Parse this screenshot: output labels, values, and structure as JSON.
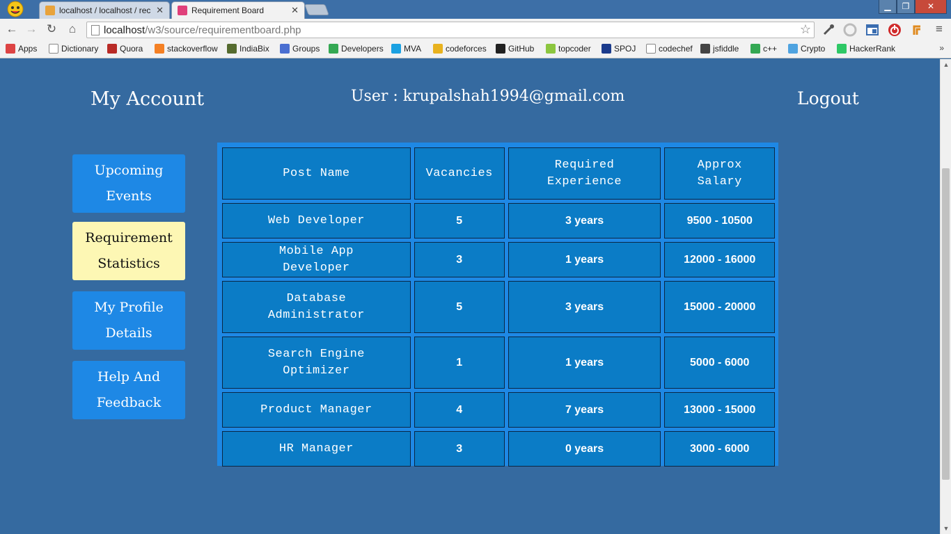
{
  "browser": {
    "tabs": [
      {
        "title": "localhost / localhost / rec",
        "favicon_color": "#e8a33c",
        "active": false
      },
      {
        "title": "Requirement Board",
        "favicon_color": "#e0407a",
        "active": true
      }
    ],
    "window_controls": {
      "minimize": "▁",
      "maximize": "❐",
      "close": "✕"
    },
    "address_bar": {
      "host": "localhost",
      "path": "/w3/source/requirementboard.php"
    },
    "bookmarks": [
      {
        "label": "Apps",
        "icon": "apps-grid-icon",
        "color": "#d44"
      },
      {
        "label": "Dictionary",
        "icon": "page-icon",
        "color": "#fff"
      },
      {
        "label": "Quora",
        "icon": "quora-icon",
        "color": "#b92b27"
      },
      {
        "label": "stackoverflow",
        "icon": "stackoverflow-icon",
        "color": "#f48024"
      },
      {
        "label": "IndiaBix",
        "icon": "indiabix-icon",
        "color": "#556b2f"
      },
      {
        "label": "Groups",
        "icon": "groups-icon",
        "color": "#4a6fd1"
      },
      {
        "label": "Developers",
        "icon": "developers-icon",
        "color": "#34a853"
      },
      {
        "label": "MVA",
        "icon": "mva-icon",
        "color": "#1ba1e2"
      },
      {
        "label": "codeforces",
        "icon": "codeforces-icon",
        "color": "#e8b21f"
      },
      {
        "label": "GitHub",
        "icon": "github-icon",
        "color": "#222"
      },
      {
        "label": "topcoder",
        "icon": "topcoder-icon",
        "color": "#8cc63f"
      },
      {
        "label": "SPOJ",
        "icon": "spoj-icon",
        "color": "#1b3b8c"
      },
      {
        "label": "codechef",
        "icon": "page-icon",
        "color": "#fff"
      },
      {
        "label": "jsfiddle",
        "icon": "jsfiddle-icon",
        "color": "#444"
      },
      {
        "label": "c++",
        "icon": "cpp-icon",
        "color": "#34a853"
      },
      {
        "label": "Crypto",
        "icon": "crypto-icon",
        "color": "#4fa3e0"
      },
      {
        "label": "HackerRank",
        "icon": "hackerrank-icon",
        "color": "#2ec866"
      }
    ],
    "bookmarks_more": "»"
  },
  "header": {
    "my_account": "My Account",
    "user_line": "User : krupalshah1994@gmail.com",
    "logout": "Logout"
  },
  "sidebar": {
    "items": [
      {
        "label": "Upcoming Events",
        "active": false
      },
      {
        "label": "Requirement Statistics",
        "active": true
      },
      {
        "label": "My Profile Details",
        "active": false
      },
      {
        "label": "Help And Feedback",
        "active": false
      }
    ]
  },
  "table": {
    "headers": [
      "Post Name",
      "Vacancies",
      "Required Experience",
      "Approx Salary"
    ],
    "rows": [
      {
        "post": "Web Developer",
        "vacancies": "5",
        "experience": "3 years",
        "salary": "9500 - 10500"
      },
      {
        "post": "Mobile App Developer",
        "vacancies": "3",
        "experience": "1 years",
        "salary": "12000 - 16000"
      },
      {
        "post": "Database Administrator",
        "vacancies": "5",
        "experience": "3 years",
        "salary": "15000 - 20000"
      },
      {
        "post": "Search Engine Optimizer",
        "vacancies": "1",
        "experience": "1 years",
        "salary": "5000 - 6000"
      },
      {
        "post": "Product Manager",
        "vacancies": "4",
        "experience": "7 years",
        "salary": "13000 - 15000"
      },
      {
        "post": "HR Manager",
        "vacancies": "3",
        "experience": "0 years",
        "salary": "3000 - 6000"
      }
    ]
  }
}
